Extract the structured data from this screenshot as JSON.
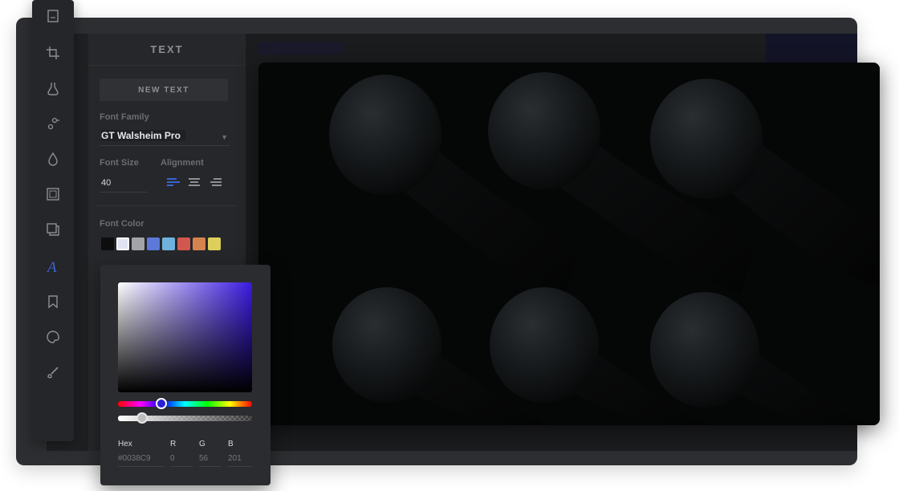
{
  "toolbar": {
    "tools": [
      {
        "icon": "crop-frame-icon"
      },
      {
        "icon": "crop-icon"
      },
      {
        "icon": "flask-icon"
      },
      {
        "icon": "adjust-sliders-icon"
      },
      {
        "icon": "drop-icon"
      },
      {
        "icon": "frame-icon"
      },
      {
        "icon": "overlay-icon"
      },
      {
        "icon": "text-icon",
        "active": true
      },
      {
        "icon": "sticker-icon"
      },
      {
        "icon": "palette-icon"
      },
      {
        "icon": "brush-icon"
      }
    ]
  },
  "text_panel": {
    "title": "TEXT",
    "new_text_label": "NEW TEXT",
    "font_family_label": "Font Family",
    "font_family_value": "GT Walsheim Pro",
    "font_size_label": "Font Size",
    "font_size_value": "40",
    "alignment_label": "Alignment",
    "alignment_selected": "left",
    "font_color_label": "Font Color",
    "swatches": [
      "#0d0d0e",
      "#dfe3f2",
      "#a3a4a8",
      "#5c78d8",
      "#6fb2de",
      "#d2584f",
      "#d5834e",
      "#ddd05a"
    ],
    "selected_swatch": 1
  },
  "color_picker": {
    "hue_color": "#3a1ae0",
    "hex_label": "Hex",
    "hex_value": "#0038C9",
    "r_label": "R",
    "r_value": "0",
    "g_label": "G",
    "g_value": "56",
    "b_label": "B",
    "b_value": "201"
  },
  "colors": {
    "accent": "#3a62d6",
    "window_bg": "#2d2e31",
    "panel_bg": "#26272a"
  }
}
